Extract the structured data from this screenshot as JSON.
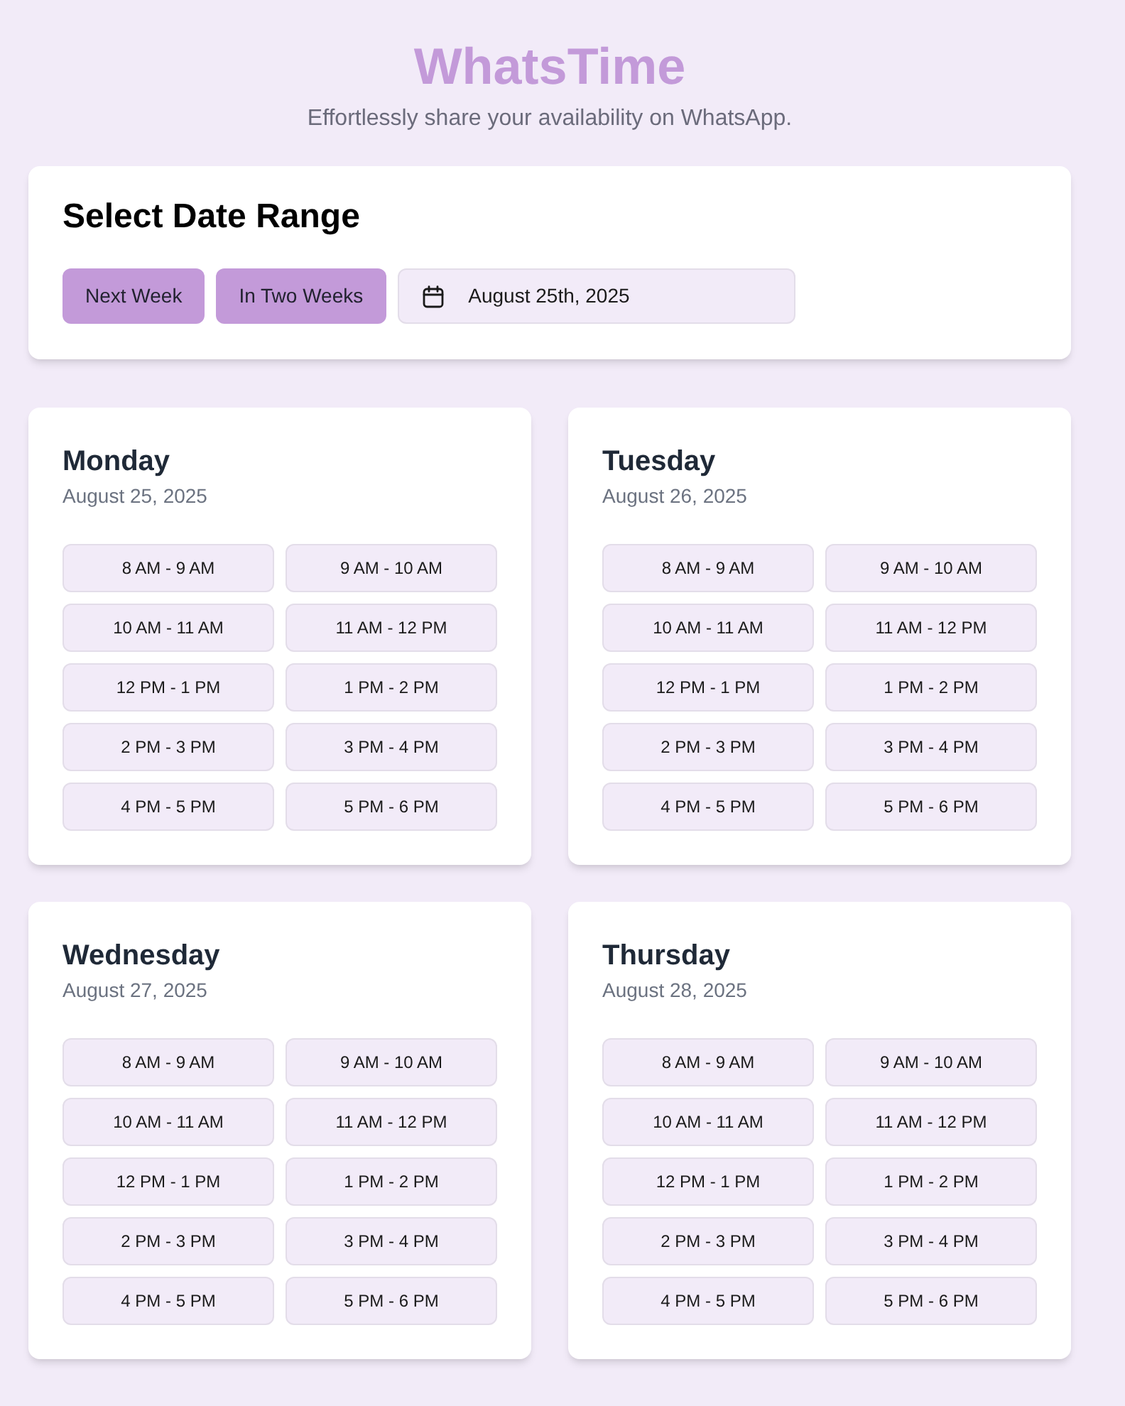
{
  "header": {
    "title": "WhatsTime",
    "subtitle": "Effortlessly share your availability on WhatsApp."
  },
  "date_range": {
    "title": "Select Date Range",
    "buttons": [
      "Next Week",
      "In Two Weeks"
    ],
    "date_field": {
      "value": "August 25th, 2025"
    }
  },
  "days": [
    {
      "name": "Monday",
      "date": "August 25, 2025",
      "slots": [
        "8 AM - 9 AM",
        "9 AM - 10 AM",
        "10 AM - 11 AM",
        "11 AM - 12 PM",
        "12 PM - 1 PM",
        "1 PM - 2 PM",
        "2 PM - 3 PM",
        "3 PM - 4 PM",
        "4 PM - 5 PM",
        "5 PM - 6 PM"
      ]
    },
    {
      "name": "Tuesday",
      "date": "August 26, 2025",
      "slots": [
        "8 AM - 9 AM",
        "9 AM - 10 AM",
        "10 AM - 11 AM",
        "11 AM - 12 PM",
        "12 PM - 1 PM",
        "1 PM - 2 PM",
        "2 PM - 3 PM",
        "3 PM - 4 PM",
        "4 PM - 5 PM",
        "5 PM - 6 PM"
      ]
    },
    {
      "name": "Wednesday",
      "date": "August 27, 2025",
      "slots": [
        "8 AM - 9 AM",
        "9 AM - 10 AM",
        "10 AM - 11 AM",
        "11 AM - 12 PM",
        "12 PM - 1 PM",
        "1 PM - 2 PM",
        "2 PM - 3 PM",
        "3 PM - 4 PM",
        "4 PM - 5 PM",
        "5 PM - 6 PM"
      ]
    },
    {
      "name": "Thursday",
      "date": "August 28, 2025",
      "slots": [
        "8 AM - 9 AM",
        "9 AM - 10 AM",
        "10 AM - 11 AM",
        "11 AM - 12 PM",
        "12 PM - 1 PM",
        "1 PM - 2 PM",
        "2 PM - 3 PM",
        "3 PM - 4 PM",
        "4 PM - 5 PM",
        "5 PM - 6 PM"
      ]
    }
  ]
}
